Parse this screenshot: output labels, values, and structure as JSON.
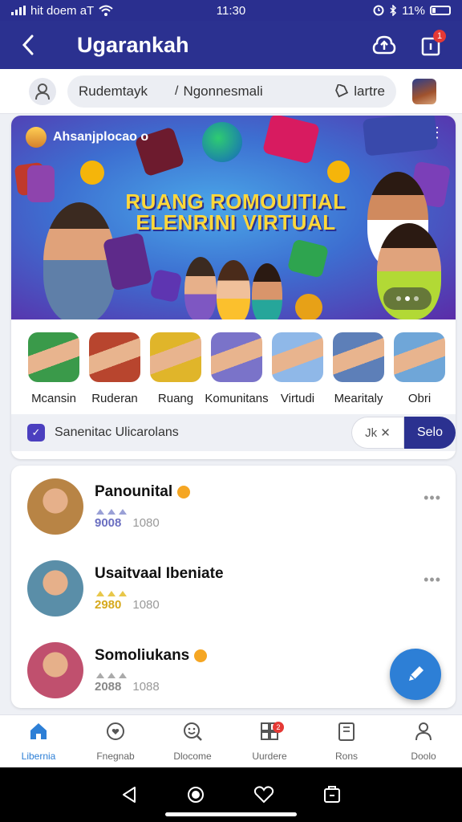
{
  "status_bar": {
    "carrier": "hit doem aT",
    "time": "11:30",
    "battery": "11%"
  },
  "app_bar": {
    "title": "Ugarankah",
    "upload_badge": "",
    "share_badge": "1"
  },
  "search_row": {
    "segment_1": "Rudemtayk",
    "segment_2": "Ngonnesmali",
    "segment_3": "lartre"
  },
  "banner": {
    "tag": "Ahsanjplocao o",
    "headline_1": "RUANG ROMOUITIAL",
    "headline_2": "ELENRINI VIRTUAL"
  },
  "categories": [
    {
      "label": "Mcansin",
      "color": "#3a9a4a"
    },
    {
      "label": "Ruderan",
      "color": "#b8452e"
    },
    {
      "label": "Ruang",
      "color": "#e0b52a"
    },
    {
      "label": "Komunitans",
      "color": "#7a73c9"
    },
    {
      "label": "Virtudi",
      "color": "#8fb8e8"
    },
    {
      "label": "Mearitaly",
      "color": "#5d7fb8"
    },
    {
      "label": "Obri",
      "color": "#6fa6d8"
    }
  ],
  "filter": {
    "text": "Sanenitac Ulicarolans",
    "clear_label": "Jk ✕",
    "select_label": "Selo"
  },
  "posts": [
    {
      "name": "Panounital",
      "count": "9008",
      "meta": "1080",
      "star_color": "#9aa0d6",
      "count_color": "#6b6fc1",
      "avatar": "#b88445"
    },
    {
      "name": "Usaitvaal Ibeniate",
      "count": "2980",
      "meta": "1080",
      "star_color": "#e8c74a",
      "count_color": "#d6a91d",
      "avatar": "#5a8ea8"
    },
    {
      "name": "Somoliukans",
      "count": "2088",
      "meta": "1088",
      "star_color": "#aaaaaa",
      "count_color": "#888888",
      "avatar": "#c0506e"
    }
  ],
  "bottom_nav": [
    {
      "label": "Libernia",
      "icon": "home-icon",
      "active": true
    },
    {
      "label": "Fnegnab",
      "icon": "heart-chat-icon",
      "active": false
    },
    {
      "label": "Dlocome",
      "icon": "smile-search-icon",
      "active": false
    },
    {
      "label": "Uurdere",
      "icon": "grid-icon",
      "active": false,
      "badge": "2"
    },
    {
      "label": "Rons",
      "icon": "tablet-icon",
      "active": false
    },
    {
      "label": "Doolo",
      "icon": "person-icon",
      "active": false
    }
  ],
  "colors": {
    "primary": "#2b3190",
    "accent": "#2d7fd6",
    "badge": "#e53935"
  }
}
